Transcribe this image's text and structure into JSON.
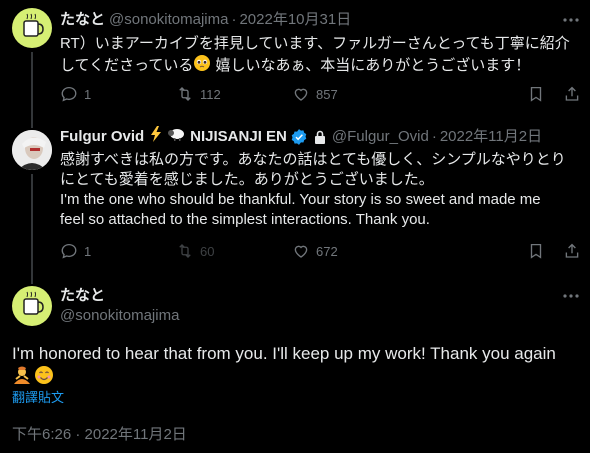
{
  "tweet1": {
    "name": "たなと",
    "handle": "@sonokitomajima",
    "date": "2022年10月31日",
    "text_line1": "RT）いまアーカイブを拝見しています、ファルガーさんとっても丁寧に紹介",
    "text_line2a": "してくださっている",
    "text_line2b": " 嬉しいなあぁ、本当にありがとうございます！",
    "replies": "1",
    "retweets": "112",
    "likes": "857"
  },
  "tweet2": {
    "name": "Fulgur Ovid",
    "name_suffix": "NIJISANJI EN",
    "handle": "@Fulgur_Ovid",
    "date": "2022年11月2日",
    "text_lines": [
      "感謝すべきは私の方です。あなたの話はとても優しく、シンプルなやりとり",
      "にとても愛着を感じました。ありがとうございました。",
      "I'm the one who should be thankful. Your story is so sweet and made me",
      "feel so attached to the simplest interactions. Thank you."
    ],
    "replies": "1",
    "retweets": "60",
    "likes": "672"
  },
  "tweet3": {
    "name": "たなと",
    "handle": "@sonokitomajima",
    "text": "I'm honored to hear that from you. I'll keep up my work! Thank you again",
    "translate_label": "翻譯貼文",
    "timestamp": "下午6:26 · 2022年11月2日"
  },
  "colors": {
    "background": "#000000",
    "text": "#e7e9ea",
    "muted": "#71767b",
    "link": "#1d9bf0",
    "avatar_bg": "#d6ef74"
  },
  "icons": [
    "mug-avatar-icon",
    "more-icon",
    "reply-icon",
    "retweet-icon",
    "like-icon",
    "bookmark-icon",
    "share-icon",
    "verified-badge-icon",
    "lock-icon",
    "lightning-icon",
    "sheep-icon",
    "pleading-face-icon",
    "person-emoji-icon",
    "smiling-face-icon"
  ]
}
